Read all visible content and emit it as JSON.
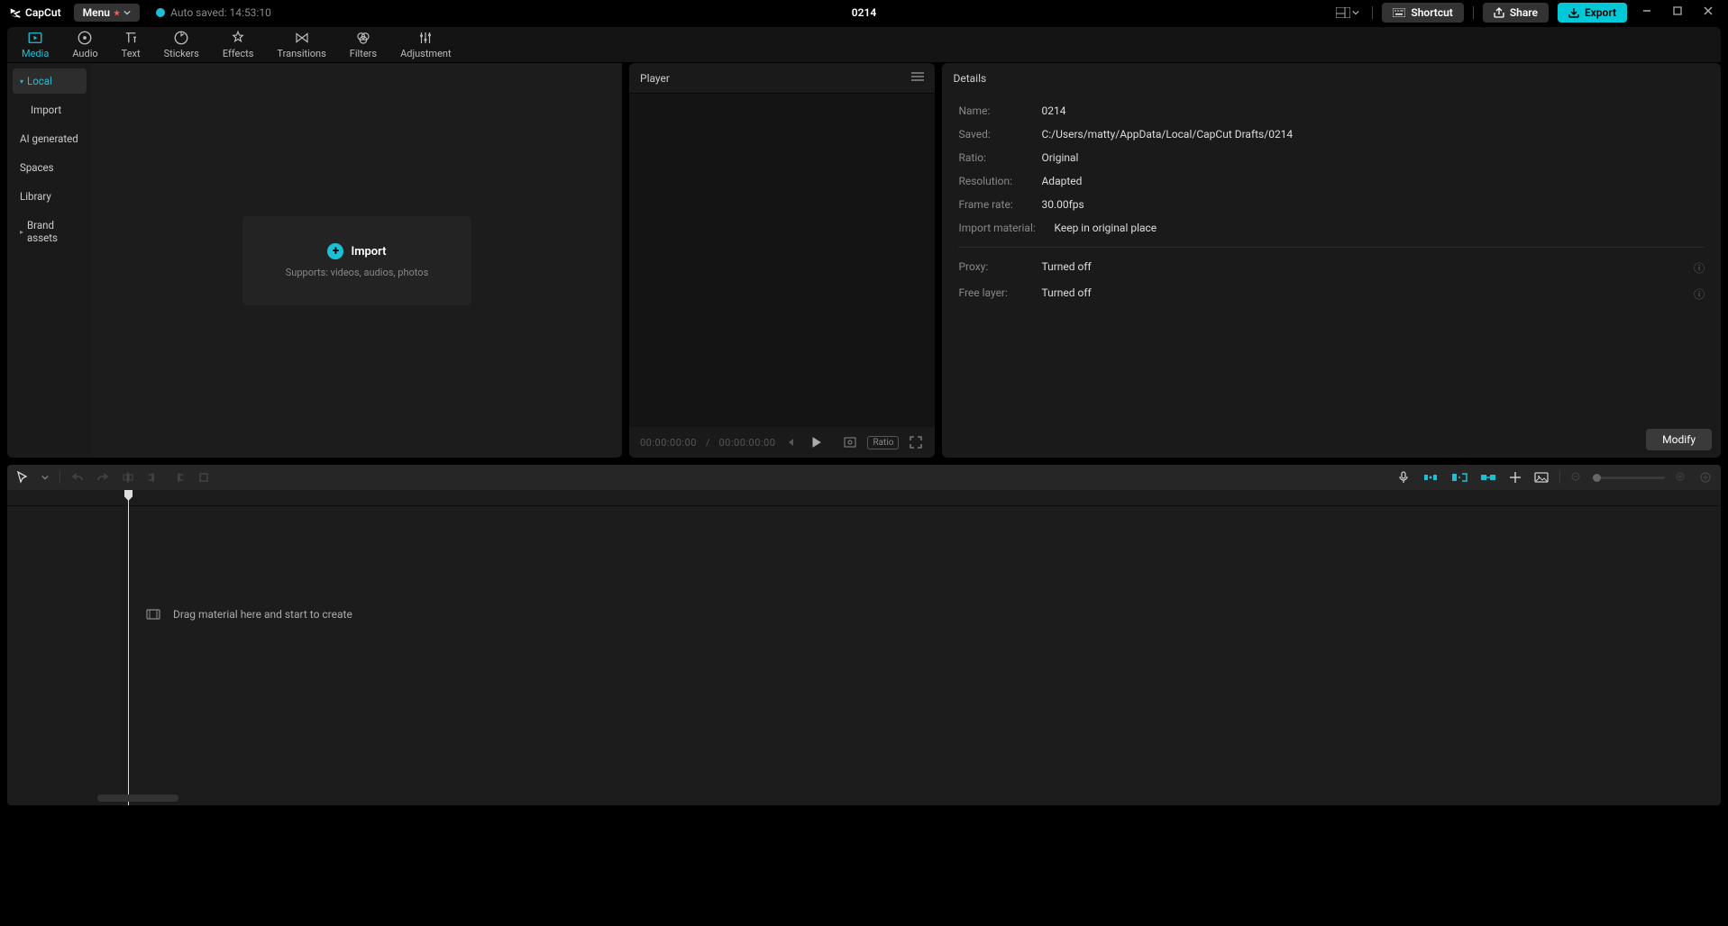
{
  "app_name": "CapCut",
  "menu_label": "Menu",
  "autosave": "Auto saved: 14:53:10",
  "project_title": "0214",
  "titlebar": {
    "shortcut": "Shortcut",
    "share": "Share",
    "export": "Export"
  },
  "tabs": [
    "Media",
    "Audio",
    "Text",
    "Stickers",
    "Effects",
    "Transitions",
    "Filters",
    "Adjustment"
  ],
  "media_sidebar": {
    "local": "Local",
    "import": "Import",
    "ai": "AI generated",
    "spaces": "Spaces",
    "library": "Library",
    "brand": "Brand assets"
  },
  "import_box": {
    "label": "Import",
    "sub": "Supports: videos, audios, photos"
  },
  "player": {
    "title": "Player",
    "tc_current": "00:00:00:00",
    "tc_total": "00:00:00:00",
    "ratio_label": "Ratio"
  },
  "details": {
    "title": "Details",
    "rows": {
      "name_k": "Name:",
      "name_v": "0214",
      "saved_k": "Saved:",
      "saved_v": "C:/Users/matty/AppData/Local/CapCut Drafts/0214",
      "ratio_k": "Ratio:",
      "ratio_v": "Original",
      "res_k": "Resolution:",
      "res_v": "Adapted",
      "fps_k": "Frame rate:",
      "fps_v": "30.00fps",
      "imp_k": "Import material:",
      "imp_v": "Keep in original place",
      "proxy_k": "Proxy:",
      "proxy_v": "Turned off",
      "free_k": "Free layer:",
      "free_v": "Turned off"
    },
    "modify": "Modify"
  },
  "timeline_empty": "Drag material here and start to create"
}
